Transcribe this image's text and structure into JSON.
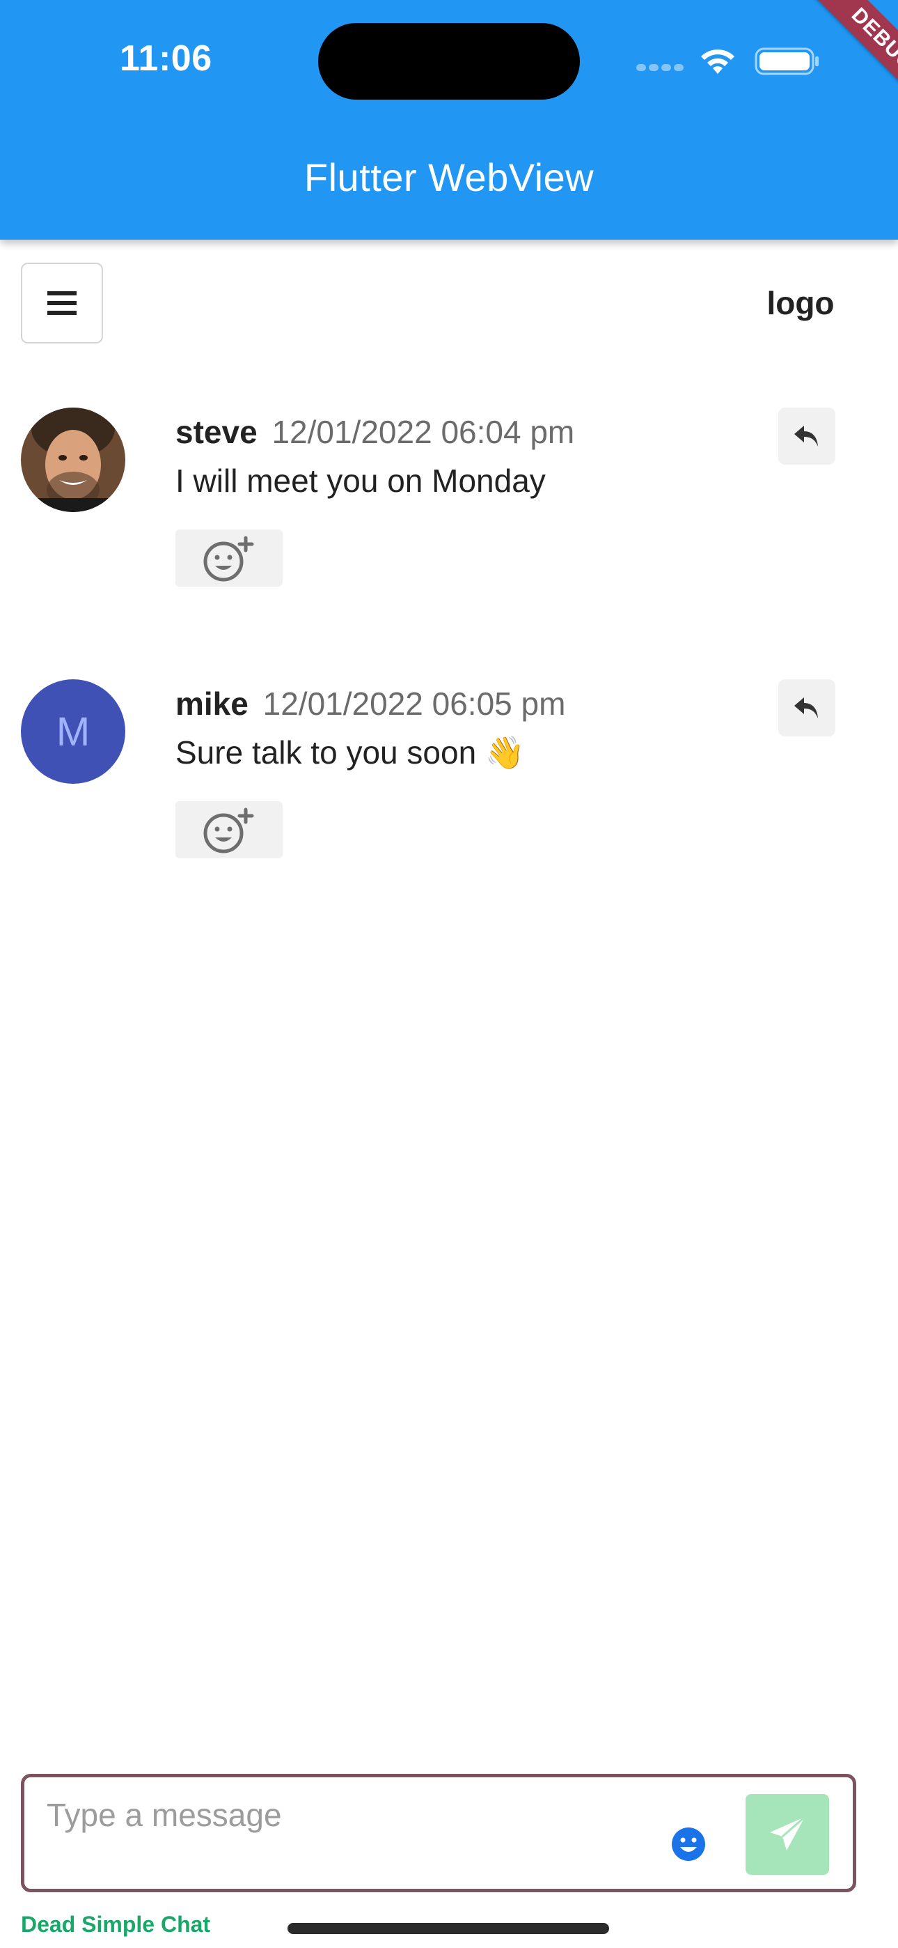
{
  "status_bar": {
    "time": "11:06"
  },
  "app_bar": {
    "title": "Flutter WebView",
    "debug_label": "DEBUG",
    "color": "#2196f3"
  },
  "header": {
    "menu_icon": "hamburger-menu-icon",
    "logo": "logo"
  },
  "messages": [
    {
      "user": "steve",
      "timestamp": "12/01/2022 06:04 pm",
      "text": "I will meet you on Monday",
      "avatar": "photo"
    },
    {
      "user": "mike",
      "timestamp": "12/01/2022 06:05 pm",
      "text": "Sure talk to you soon 👋",
      "avatar_letter": "M",
      "avatar_color": "#3f51b5"
    }
  ],
  "composer": {
    "placeholder": "Type a message",
    "send_color": "#a6e4b9",
    "border_color": "#7a5560"
  },
  "footer": {
    "brand": "Dead Simple Chat"
  }
}
